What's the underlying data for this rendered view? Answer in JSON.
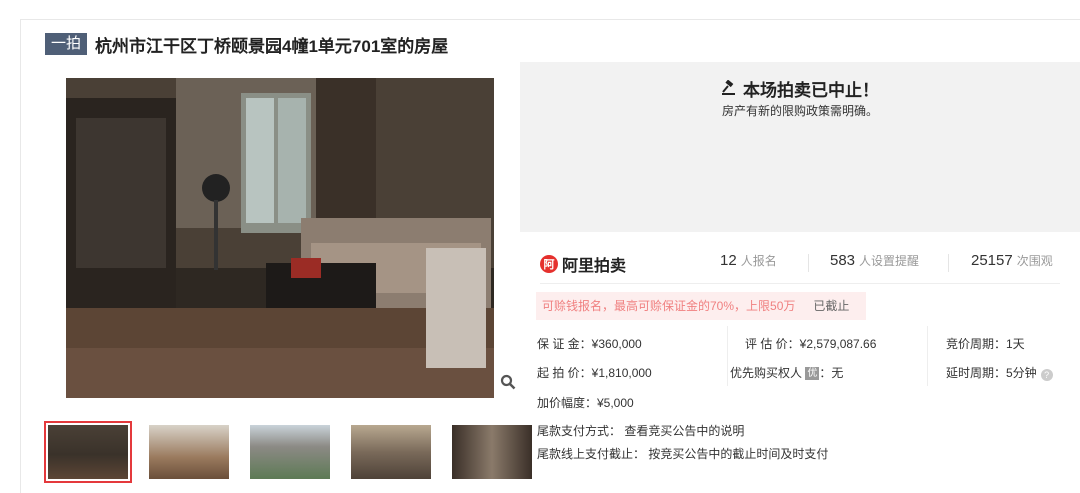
{
  "lot": {
    "badge": "一拍",
    "title": "杭州市江干区丁桥颐景园4幢1单元701室的房屋"
  },
  "status": {
    "headline": "本场拍卖已中止！",
    "reason": "房产有新的限购政策需明确。"
  },
  "platform": {
    "logo_mark": "阿",
    "name": "阿里拍卖"
  },
  "stats": {
    "signups": "12",
    "signups_label": "人报名",
    "reminders": "583",
    "reminders_label": "人设置提醒",
    "views": "25157",
    "views_label": "次围观"
  },
  "notice": {
    "text": "可赊钱报名，最高可赊保证金的70%，上限50万",
    "status": "已截止"
  },
  "details": {
    "deposit": "保 证 金：¥360,000",
    "appraisal": "评 估 价：¥2,579,087.66",
    "cycle": "竞价周期：1天",
    "start_price": "起 拍 价：¥1,810,000",
    "priority_label": "优先购买权人",
    "priority_badge": "优",
    "priority_value": "：无",
    "extension": "延时周期：5分钟",
    "increment": "加价幅度：¥5,000",
    "payment_method": "尾款支付方式：  查看竞买公告中的说明",
    "payment_deadline": "尾款线上支付截止：  按竞买公告中的截止时间及时支付"
  },
  "icons": {
    "zoom": "magnifier-icon",
    "gavel": "gavel-icon",
    "help": "question-icon"
  },
  "colors": {
    "accent": "#e4393c",
    "badge": "#4f5f77",
    "panel": "#f2f2f2"
  }
}
